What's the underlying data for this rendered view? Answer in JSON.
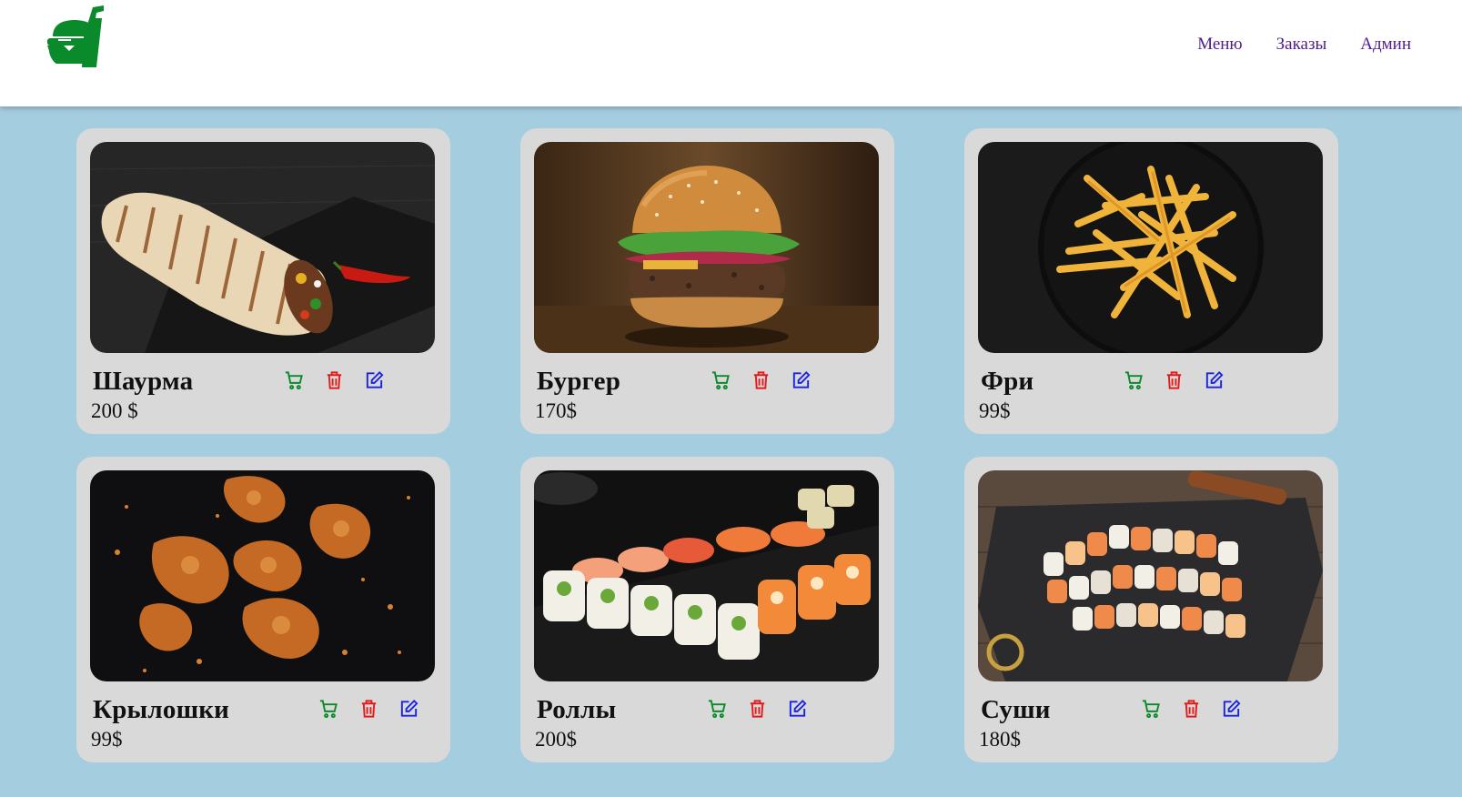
{
  "header": {
    "logo_icon": "burger-drink-logo-icon",
    "nav": [
      {
        "label": "Меню"
      },
      {
        "label": "Заказы"
      },
      {
        "label": "Админ"
      }
    ]
  },
  "colors": {
    "background": "#a5cde0",
    "card": "#d9d9d9",
    "nav_link": "#4f1d8f",
    "cart_icon": "#0a8a2a",
    "delete_icon": "#e31b1b",
    "edit_icon": "#1a24e0",
    "logo": "#0a8a2a"
  },
  "products": [
    {
      "name": "Шаурма",
      "price": "200 $",
      "image": "shawarma-photo"
    },
    {
      "name": "Бургер",
      "price": "170$",
      "image": "burger-photo"
    },
    {
      "name": "Фри",
      "price": "99$",
      "image": "fries-photo"
    },
    {
      "name": "Крылошки",
      "price": "99$",
      "image": "chicken-wings-photo"
    },
    {
      "name": "Роллы",
      "price": "200$",
      "image": "rolls-photo"
    },
    {
      "name": "Суши",
      "price": "180$",
      "image": "sushi-photo"
    }
  ],
  "card_actions": [
    "cart-icon",
    "trash-icon",
    "edit-icon"
  ]
}
